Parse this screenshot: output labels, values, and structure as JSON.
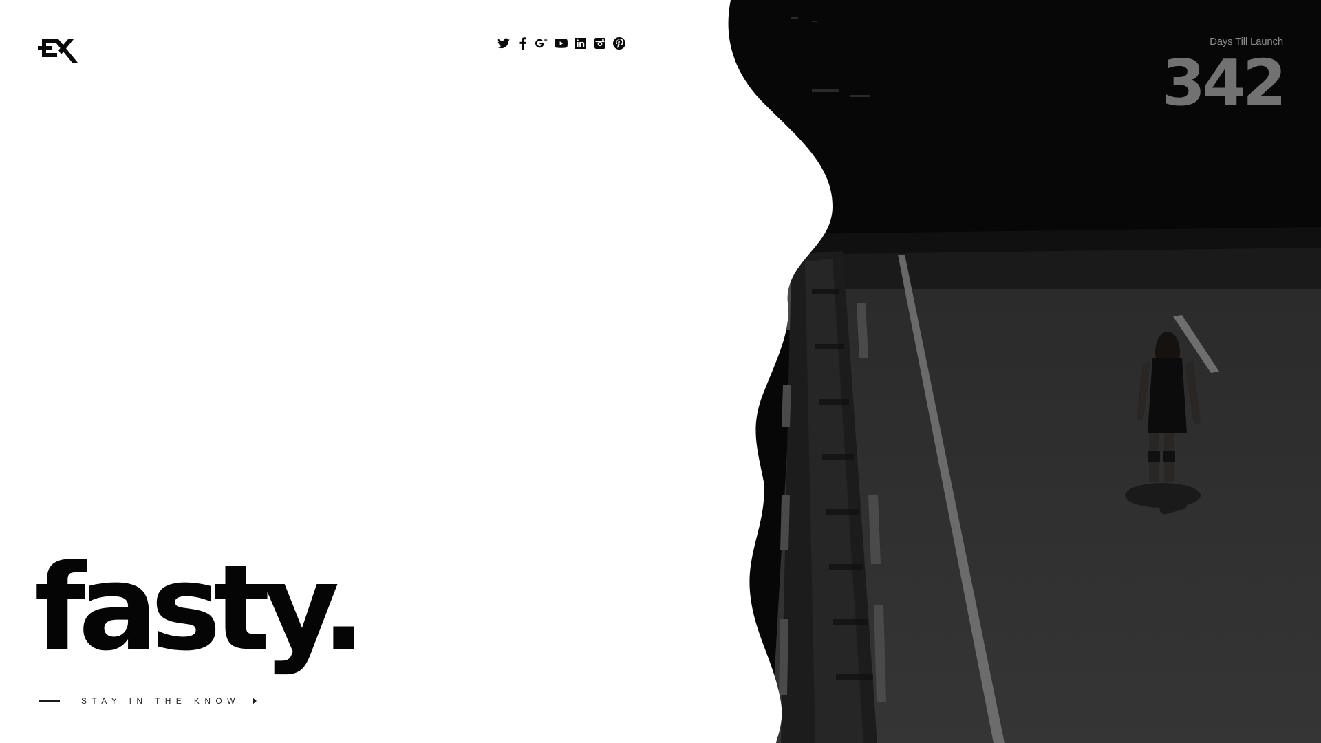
{
  "brand": {
    "logo_text": "EX"
  },
  "social": [
    {
      "name": "twitter-icon"
    },
    {
      "name": "facebook-icon"
    },
    {
      "name": "google-plus-icon"
    },
    {
      "name": "youtube-icon"
    },
    {
      "name": "linkedin-icon"
    },
    {
      "name": "instagram-icon"
    },
    {
      "name": "pinterest-icon"
    }
  ],
  "countdown": {
    "label": "Days Till Launch",
    "value": "342"
  },
  "hero": {
    "title": "fasty."
  },
  "newsletter": {
    "label": "STAY IN THE KNOW"
  },
  "colors": {
    "background": "#ffffff",
    "photo_dark": "#0a0a0a",
    "text_primary": "#050505",
    "countdown_number": "#727272"
  }
}
